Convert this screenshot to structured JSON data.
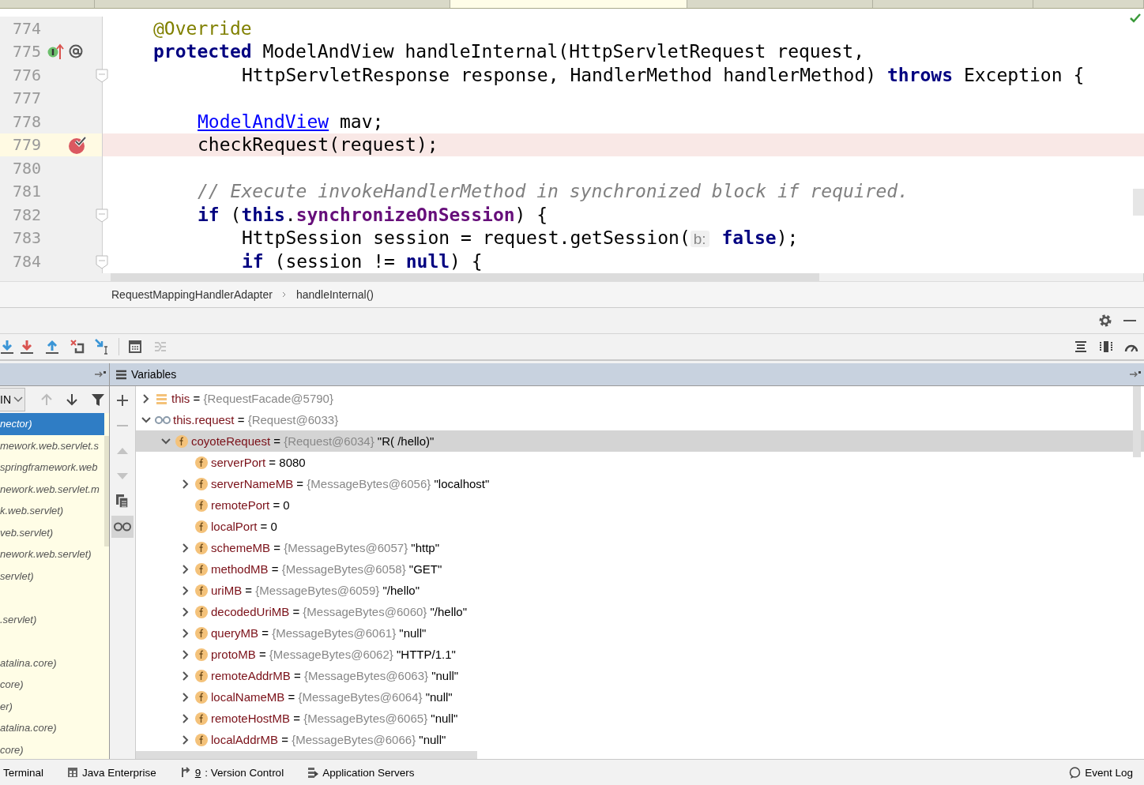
{
  "editor_tabs": [
    {
      "selected": false
    },
    {
      "selected": false
    },
    {
      "selected": true
    },
    {
      "selected": false
    },
    {
      "selected": false
    },
    {
      "selected": false
    }
  ],
  "code": {
    "lines": [
      {
        "number": "774",
        "current": false,
        "kind": "member",
        "tokens": [
          {
            "text": "@Override",
            "kind": "annotation"
          }
        ]
      },
      {
        "number": "775",
        "current": false,
        "kind": "member",
        "marker": {
          "kind": "override"
        },
        "tokens": [
          {
            "text": "protected",
            "kind": "keyword"
          },
          {
            "text": " ModelAndView handleInternal(HttpServletRequest request,",
            "kind": "plain"
          }
        ]
      },
      {
        "number": "776",
        "current": false,
        "kind": "inner",
        "marker": {
          "kind": "fold"
        },
        "tokens": [
          {
            "text": "HttpServletResponse response, HandlerMethod handlerMethod) ",
            "kind": "plain"
          },
          {
            "text": "throws",
            "kind": "keyword"
          },
          {
            "text": " Exception {",
            "kind": "plain"
          }
        ]
      },
      {
        "number": "777",
        "current": false,
        "kind": "body"
      },
      {
        "number": "778",
        "current": false,
        "kind": "body",
        "tokens": [
          {
            "text": "ModelAndView",
            "kind": "link"
          },
          {
            "text": " mav;",
            "kind": "plain"
          }
        ]
      },
      {
        "number": "779",
        "current": true,
        "kind": "body",
        "marker": {
          "kind": "breakpoint"
        },
        "tokens": [
          {
            "text": "checkRequest(request);",
            "kind": "plain"
          }
        ]
      },
      {
        "number": "780",
        "current": false,
        "kind": "body"
      },
      {
        "number": "781",
        "current": false,
        "kind": "body",
        "tokens": [
          {
            "text": "// Execute invokeHandlerMethod in synchronized block if required.",
            "kind": "comment"
          }
        ]
      },
      {
        "number": "782",
        "current": false,
        "kind": "body",
        "marker": {
          "kind": "fold"
        },
        "tokens": [
          {
            "text": "if",
            "kind": "keyword"
          },
          {
            "text": " (",
            "kind": "plain"
          },
          {
            "text": "this",
            "kind": "keyword"
          },
          {
            "text": ".",
            "kind": "plain"
          },
          {
            "text": "synchronizeOnSession",
            "kind": "field"
          },
          {
            "text": ") {",
            "kind": "plain"
          }
        ]
      },
      {
        "number": "783",
        "current": false,
        "kind": "inner",
        "tokens": [
          {
            "text": "HttpSession session = request.getSession(",
            "kind": "plain"
          },
          {
            "text": "b:",
            "kind": "hint"
          },
          {
            "text": "false",
            "kind": "keyword"
          },
          {
            "text": ");",
            "kind": "plain"
          }
        ]
      },
      {
        "number": "784",
        "current": false,
        "kind": "inner",
        "marker": {
          "kind": "fold"
        },
        "tokens": [
          {
            "text": "if",
            "kind": "keyword"
          },
          {
            "text": " (session != ",
            "kind": "plain"
          },
          {
            "text": "null",
            "kind": "keyword"
          },
          {
            "text": ") {",
            "kind": "plain"
          }
        ]
      }
    ]
  },
  "breadcrumb": [
    "RequestMappingHandlerAdapter",
    "handleInternal()"
  ],
  "frames": {
    "dropdown": "IN",
    "items": [
      {
        "label": "nector)",
        "selected": true
      },
      {
        "label": "mework.web.servlet.s",
        "selected": false
      },
      {
        "label": "springframework.web",
        "selected": false
      },
      {
        "label": "nework.web.servlet.m",
        "selected": false
      },
      {
        "label": "k.web.servlet)",
        "selected": false
      },
      {
        "label": "veb.servlet)",
        "selected": false
      },
      {
        "label": "nework.web.servlet)",
        "selected": false
      },
      {
        "label": "servlet)",
        "selected": false
      },
      {
        "selected": false
      },
      {
        "label": ".servlet)",
        "selected": false
      },
      {
        "selected": false
      },
      {
        "label": "atalina.core)",
        "selected": false
      },
      {
        "label": "core)",
        "selected": false
      },
      {
        "label": "er)",
        "selected": false
      },
      {
        "label": "atalina.core)",
        "selected": false
      },
      {
        "label": "core)",
        "selected": false
      }
    ]
  },
  "variables": {
    "title": "Variables",
    "items": [
      {
        "kind": "local",
        "name": "this",
        "op": "=",
        "ref": "{RequestFacade@5790}",
        "expandable": true,
        "expanded": false,
        "selected": false
      },
      {
        "kind": "watch",
        "name": "this.request",
        "op": "=",
        "ref": "{Request@6033}",
        "expandable": true,
        "expanded": true,
        "selected": false,
        "children": [
          {
            "kind": "field",
            "name": "coyoteRequest",
            "op": "=",
            "ref": "{Request@6034}",
            "value": "\"R( /hello)\"",
            "expandable": true,
            "expanded": true,
            "selected": true,
            "children": [
              {
                "kind": "field",
                "name": "serverPort",
                "op": "=",
                "value": "8080",
                "expandable": false,
                "selected": false
              },
              {
                "kind": "field",
                "name": "serverNameMB",
                "op": "=",
                "ref": "{MessageBytes@6056}",
                "value": "\"localhost\"",
                "expandable": true,
                "expanded": false,
                "selected": false
              },
              {
                "kind": "field",
                "name": "remotePort",
                "op": "=",
                "value": "0",
                "expandable": false,
                "selected": false
              },
              {
                "kind": "field",
                "name": "localPort",
                "op": "=",
                "value": "0",
                "expandable": false,
                "selected": false
              },
              {
                "kind": "field",
                "name": "schemeMB",
                "op": "=",
                "ref": "{MessageBytes@6057}",
                "value": "\"http\"",
                "expandable": true,
                "expanded": false,
                "selected": false
              },
              {
                "kind": "field",
                "name": "methodMB",
                "op": "=",
                "ref": "{MessageBytes@6058}",
                "value": "\"GET\"",
                "expandable": true,
                "expanded": false,
                "selected": false
              },
              {
                "kind": "field",
                "name": "uriMB",
                "op": "=",
                "ref": "{MessageBytes@6059}",
                "value": "\"/hello\"",
                "expandable": true,
                "expanded": false,
                "selected": false
              },
              {
                "kind": "field",
                "name": "decodedUriMB",
                "op": "=",
                "ref": "{MessageBytes@6060}",
                "value": "\"/hello\"",
                "expandable": true,
                "expanded": false,
                "selected": false
              },
              {
                "kind": "field",
                "name": "queryMB",
                "op": "=",
                "ref": "{MessageBytes@6061}",
                "value": "\"null\"",
                "expandable": true,
                "expanded": false,
                "selected": false
              },
              {
                "kind": "field",
                "name": "protoMB",
                "op": "=",
                "ref": "{MessageBytes@6062}",
                "value": "\"HTTP/1.1\"",
                "expandable": true,
                "expanded": false,
                "selected": false
              },
              {
                "kind": "field",
                "name": "remoteAddrMB",
                "op": "=",
                "ref": "{MessageBytes@6063}",
                "value": "\"null\"",
                "expandable": true,
                "expanded": false,
                "selected": false
              },
              {
                "kind": "field",
                "name": "localNameMB",
                "op": "=",
                "ref": "{MessageBytes@6064}",
                "value": "\"null\"",
                "expandable": true,
                "expanded": false,
                "selected": false
              },
              {
                "kind": "field",
                "name": "remoteHostMB",
                "op": "=",
                "ref": "{MessageBytes@6065}",
                "value": "\"null\"",
                "expandable": true,
                "expanded": false,
                "selected": false
              },
              {
                "kind": "field",
                "name": "localAddrMB",
                "op": "=",
                "ref": "{MessageBytes@6066}",
                "value": "\"null\"",
                "expandable": true,
                "expanded": false,
                "selected": false
              }
            ]
          }
        ]
      }
    ]
  },
  "status_bar": [
    {
      "kind": "terminal",
      "label": "Terminal"
    },
    {
      "kind": "java",
      "label": "Java Enterprise"
    },
    {
      "kind": "vcs",
      "mnemonic": "9",
      "label": ": Version Control"
    },
    {
      "kind": "servers",
      "label": "Application Servers"
    },
    {
      "kind": "eventlog",
      "label": "Event Log"
    }
  ]
}
